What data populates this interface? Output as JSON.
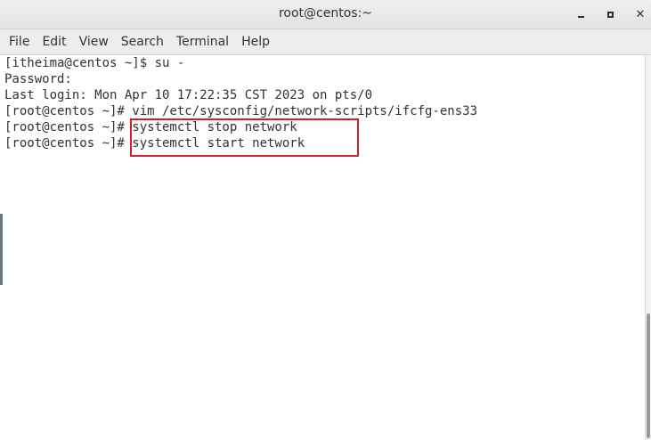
{
  "window": {
    "title": "root@centos:~",
    "min_label": "",
    "max_label": "",
    "close_label": "✕"
  },
  "menu": {
    "file": "File",
    "edit": "Edit",
    "view": "View",
    "search": "Search",
    "terminal": "Terminal",
    "help": "Help"
  },
  "terminal": {
    "lines": [
      "[itheima@centos ~]$ su -",
      "Password:",
      "Last login: Mon Apr 10 17:22:35 CST 2023 on pts/0",
      "[root@centos ~]# vim /etc/sysconfig/network-scripts/ifcfg-ens33",
      "[root@centos ~]# systemctl stop network",
      "[root@centos ~]# systemctl start network"
    ]
  },
  "colors": {
    "highlight": "#d0202a",
    "text": "#2e3436"
  }
}
